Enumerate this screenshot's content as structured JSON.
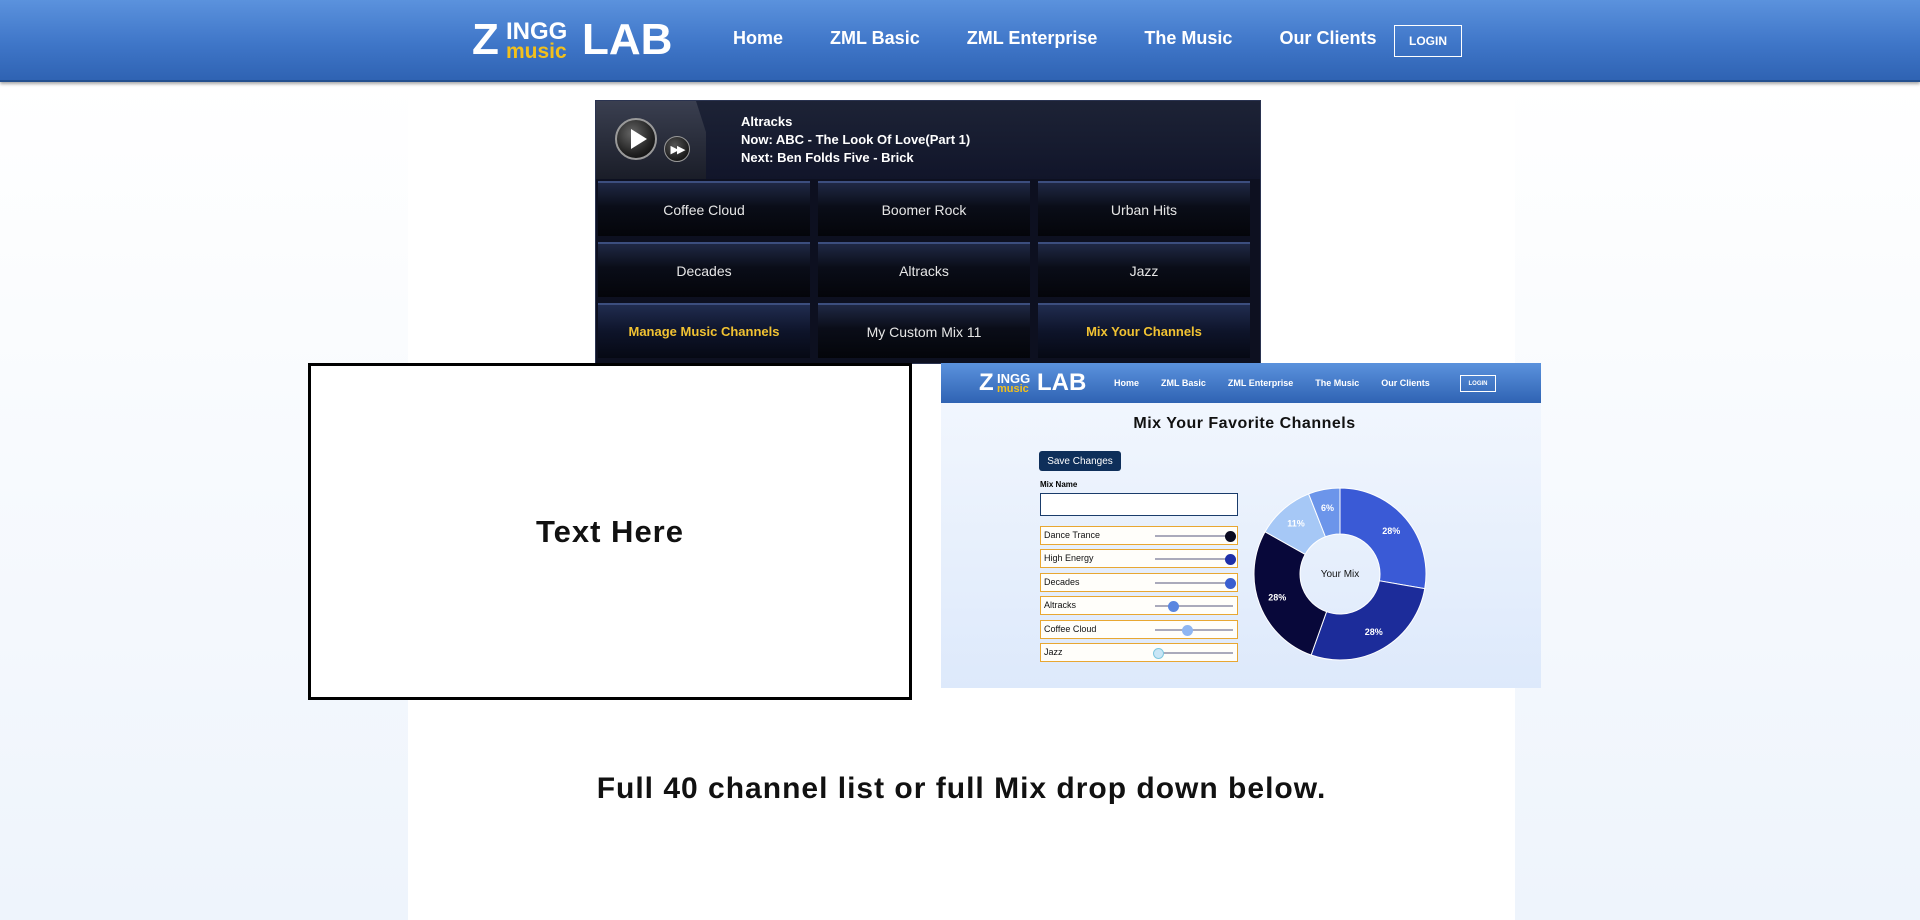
{
  "header": {
    "logo": {
      "z": "Z",
      "ingg": "INGG",
      "music": "music",
      "lab": "LAB"
    },
    "nav": [
      "Home",
      "ZML Basic",
      "ZML Enterprise",
      "The Music",
      "Our Clients"
    ],
    "login_label": "LOGIN"
  },
  "player": {
    "channel": "Altracks",
    "now": "Now: ABC - The Look Of Love(Part 1)",
    "next": "Next: Ben Folds Five - Brick",
    "channels": [
      {
        "label": "Coffee Cloud"
      },
      {
        "label": "Boomer Rock"
      },
      {
        "label": "Urban Hits"
      },
      {
        "label": "Decades"
      },
      {
        "label": "Altracks"
      },
      {
        "label": "Jazz"
      },
      {
        "label": "Manage Music Channels",
        "accent": true
      },
      {
        "label": "My Custom Mix 11"
      },
      {
        "label": "Mix Your Channels",
        "accent": true
      }
    ]
  },
  "textbox": {
    "text": "Text Here"
  },
  "mini_screen": {
    "nav": [
      "Home",
      "ZML Basic",
      "ZML Enterprise",
      "The Music",
      "Our Clients"
    ],
    "login_label": "LOGIN",
    "title": "Mix Your Favorite Channels",
    "save_label": "Save Changes",
    "mix_name_label": "Mix Name",
    "mix_name_value": "",
    "sliders": [
      {
        "label": "Dance Trance",
        "level": 0.95,
        "color": "#0a0a1f"
      },
      {
        "label": "High Energy",
        "level": 0.95,
        "color": "#1e2fa8"
      },
      {
        "label": "Decades",
        "level": 0.95,
        "color": "#3a5fd0"
      },
      {
        "label": "Altracks",
        "level": 0.22,
        "color": "#5a86e0"
      },
      {
        "label": "Coffee Cloud",
        "level": 0.4,
        "color": "#8fb6f2"
      },
      {
        "label": "Jazz",
        "level": 0.02,
        "color": "#c9e6f6"
      }
    ],
    "donut": {
      "center_label": "Your Mix",
      "slices": [
        {
          "label": "28%",
          "value": 28,
          "color": "#3a5ad6"
        },
        {
          "label": "28%",
          "value": 28,
          "color": "#1c2c9a"
        },
        {
          "label": "28%",
          "value": 28,
          "color": "#08083a"
        },
        {
          "label": "11%",
          "value": 11,
          "color": "#a6c8f6"
        },
        {
          "label": "6%",
          "value": 6,
          "color": "#6c95ea"
        }
      ]
    }
  },
  "bottom_text": "Full 40 channel list or full Mix drop down below.",
  "colors": {
    "nav_blue": "#3f76c8",
    "accent_yellow": "#f1c232",
    "player_dark": "#0d1020"
  }
}
